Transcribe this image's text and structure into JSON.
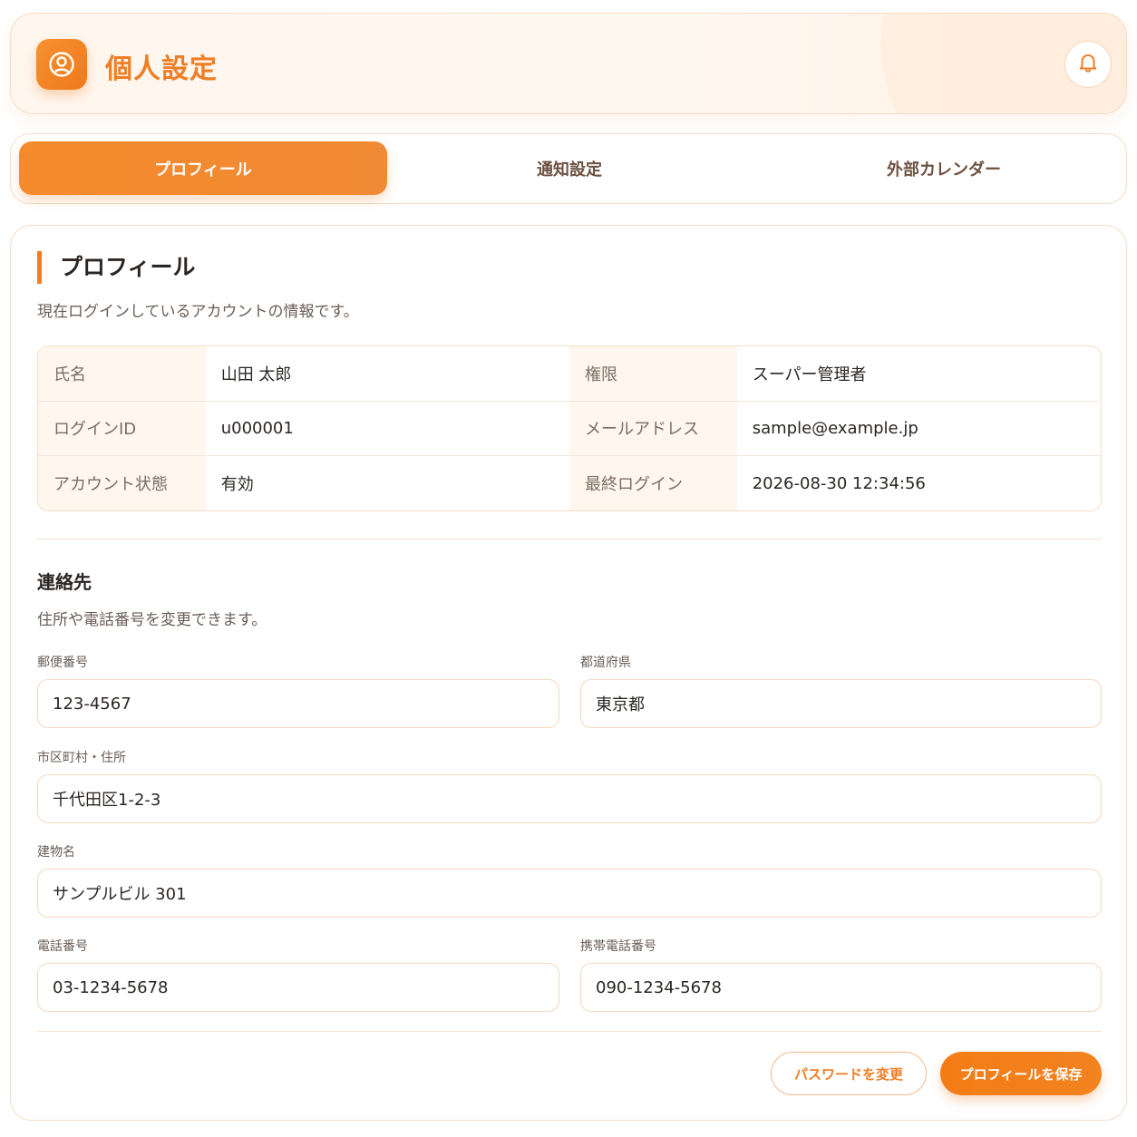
{
  "colors": {
    "accent": "#ef7e26",
    "accent_light": "#fff6ed",
    "border": "#f6dcc4"
  },
  "header": {
    "title": "個人設定",
    "app_icon": "user-circle-icon",
    "bell_icon": "bell-icon"
  },
  "tabs": [
    {
      "label": "プロフィール",
      "active": true
    },
    {
      "label": "通知設定",
      "active": false
    },
    {
      "label": "外部カレンダー",
      "active": false
    }
  ],
  "profile": {
    "title": "プロフィール",
    "description": "現在ログインしているアカウントの情報です。",
    "rows": [
      [
        {
          "label": "氏名",
          "value": "山田 太郎"
        },
        {
          "label": "権限",
          "value": "スーパー管理者"
        }
      ],
      [
        {
          "label": "ログインID",
          "value": "u000001"
        },
        {
          "label": "メールアドレス",
          "value": "sample@example.jp"
        }
      ],
      [
        {
          "label": "アカウント状態",
          "value": "有効"
        },
        {
          "label": "最終ログイン",
          "value": "2026-08-30 12:34:56"
        }
      ]
    ]
  },
  "contact": {
    "title": "連絡先",
    "description": "住所や電話番号を変更できます。",
    "postal_code": {
      "label": "郵便番号",
      "value": "123-4567"
    },
    "prefecture": {
      "label": "都道府県",
      "value": "東京都"
    },
    "address": {
      "label": "市区町村・住所",
      "value": "千代田区1-2-3"
    },
    "building": {
      "label": "建物名",
      "value": "サンプルビル 301"
    },
    "phone": {
      "label": "電話番号",
      "value": "03-1234-5678"
    },
    "mobile": {
      "label": "携帯電話番号",
      "value": "090-1234-5678"
    }
  },
  "actions": {
    "change_password": "パスワードを変更",
    "save_profile": "プロフィールを保存"
  }
}
